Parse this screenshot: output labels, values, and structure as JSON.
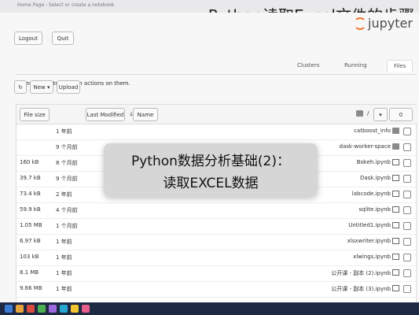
{
  "overlay_title": "Python读取Excel文件的步骤",
  "browser": {
    "tab_text": "Home Page - Select or create a notebook"
  },
  "header": {
    "logout_label": "Logout",
    "quit_label": "Quit",
    "logo_text": "jupyter"
  },
  "tabs": [
    {
      "label": "Files",
      "active": true
    },
    {
      "label": "Running",
      "active": false
    },
    {
      "label": "Clusters",
      "active": false
    }
  ],
  "hint_text": "Select items to perform actions on them.",
  "toolbar": {
    "upload_label": "Upload",
    "new_label": "New ▾",
    "refresh_icon": "refresh-icon"
  },
  "list_header": {
    "file_size_label": "File size",
    "last_modified_label": "Last Modified",
    "name_label": "Name",
    "select_count": "0",
    "breadcrumb_root": "/"
  },
  "rows": [
    {
      "size": "",
      "modified": "1 年前",
      "name": "catboost_info",
      "type": "folder"
    },
    {
      "size": "",
      "modified": "9 个月前",
      "name": "dask-worker-space",
      "type": "folder"
    },
    {
      "size": "160 kB",
      "modified": "8 个月前",
      "name": "Bokeh.ipynb",
      "type": "notebook"
    },
    {
      "size": "39.7 kB",
      "modified": "9 个月前",
      "name": "Dask.ipynb",
      "type": "notebook"
    },
    {
      "size": "73.4 kB",
      "modified": "2 年前",
      "name": "labcode.ipynb",
      "type": "notebook"
    },
    {
      "size": "59.9 kB",
      "modified": "4 个月前",
      "name": "sqlite.ipynb",
      "type": "notebook"
    },
    {
      "size": "1.05 MB",
      "modified": "1 个月前",
      "name": "Untitled1.ipynb",
      "type": "notebook"
    },
    {
      "size": "6.97 kB",
      "modified": "1 年前",
      "name": "xlsxwriter.ipynb",
      "type": "notebook"
    },
    {
      "size": "103 kB",
      "modified": "1 年前",
      "name": "xlwings.ipynb",
      "type": "notebook"
    },
    {
      "size": "8.1 MB",
      "modified": "1 年前",
      "name": "公开课 - 副本 (2).ipynb",
      "type": "notebook"
    },
    {
      "size": "9.66 MB",
      "modified": "1 年前",
      "name": "公开课 - 副本 (3).ipynb",
      "type": "notebook"
    }
  ],
  "overlay_box": {
    "line1": "Python数据分析基础(2)：",
    "line2": "读取EXCEL数据"
  }
}
